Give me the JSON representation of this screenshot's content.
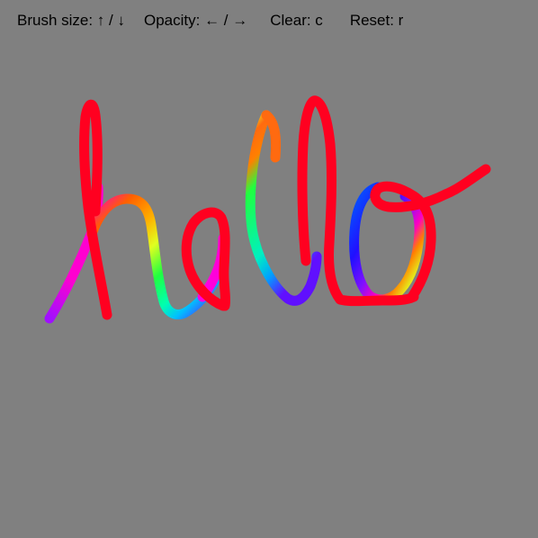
{
  "app": {
    "background_color": "#808080"
  },
  "help_bar": {
    "brush_size": "Brush size: ↑ / ↓",
    "opacity": "Opacity: ← / →",
    "clear": "Clear: c",
    "reset": "Reset: r"
  },
  "drawing": {
    "description_text_written": "hello",
    "stroke_colors": {
      "red": "#ff0020",
      "magenta": "#ff00d0",
      "violet": "#9010ff",
      "blue": "#2020ff",
      "cyan": "#00e0f0",
      "green": "#20ff40",
      "yellow": "#e0ff20",
      "orange": "#ff8000"
    }
  }
}
